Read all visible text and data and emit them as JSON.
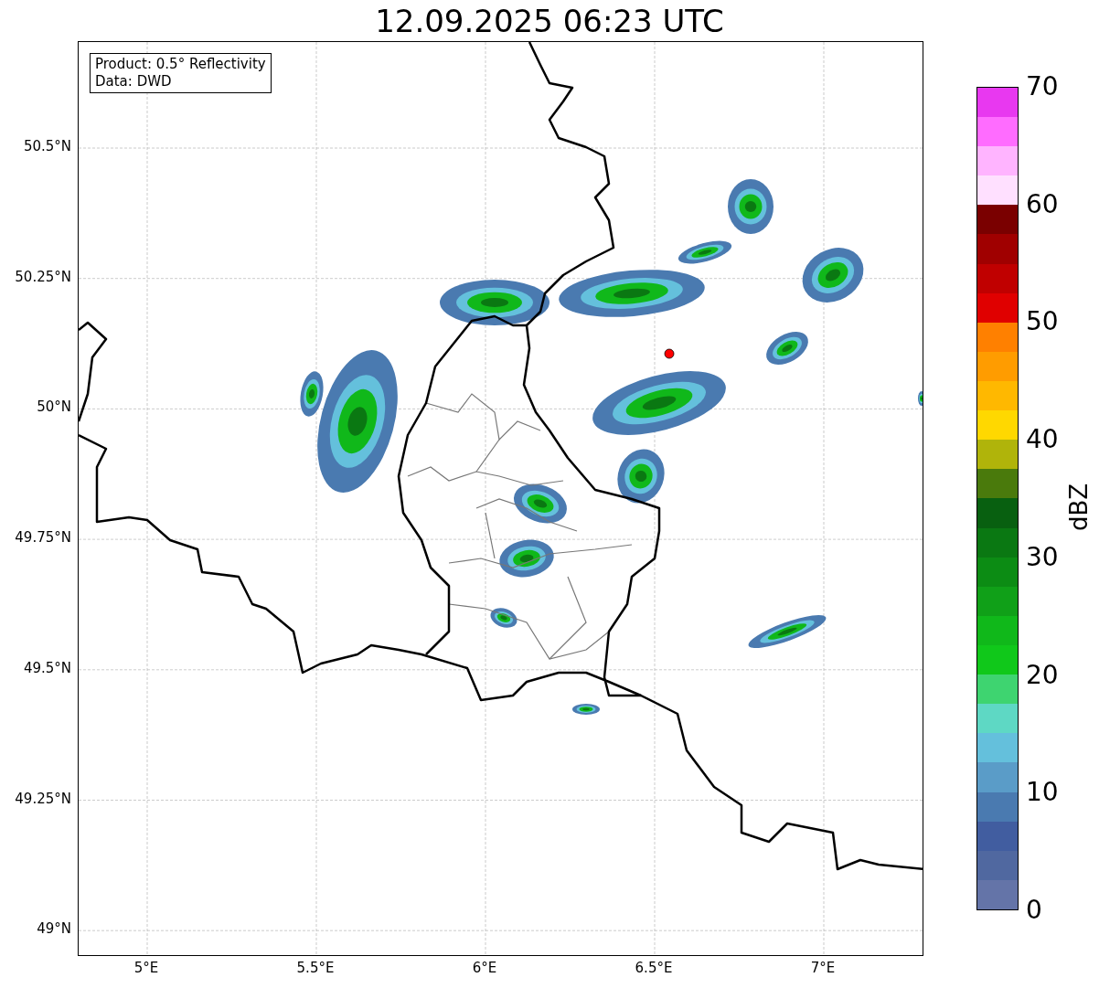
{
  "title": "12.09.2025 06:23 UTC",
  "info_box": [
    "Product: 0.5° Reflectivity",
    "Data: DWD"
  ],
  "x_axis_ticks": [
    "5°E",
    "5.5°E",
    "6°E",
    "6.5°E",
    "7°E"
  ],
  "y_axis_ticks": [
    "50.5°N",
    "50.25°N",
    "50°N",
    "49.75°N",
    "49.5°N",
    "49.25°N",
    "49°N"
  ],
  "colorbar": {
    "label": "dBZ",
    "ticks": [
      "70",
      "60",
      "50",
      "40",
      "30",
      "20",
      "10",
      "0"
    ],
    "steps": [
      {
        "color": "#6474a8"
      },
      {
        "color": "#5068a0"
      },
      {
        "color": "#415da0"
      },
      {
        "color": "#4a7ab0"
      },
      {
        "color": "#5a9cc8"
      },
      {
        "color": "#64c0dc"
      },
      {
        "color": "#5ed8c4"
      },
      {
        "color": "#3ed470"
      },
      {
        "color": "#10c81a"
      },
      {
        "color": "#10b81a"
      },
      {
        "color": "#10a018"
      },
      {
        "color": "#0c8c14"
      },
      {
        "color": "#0a7812"
      },
      {
        "color": "#086010"
      },
      {
        "color": "#4a7a0c"
      },
      {
        "color": "#b0b40a"
      },
      {
        "color": "#ffd800"
      },
      {
        "color": "#ffb800"
      },
      {
        "color": "#ff9c00"
      },
      {
        "color": "#ff8000"
      },
      {
        "color": "#e00000"
      },
      {
        "color": "#c00000"
      },
      {
        "color": "#a00000"
      },
      {
        "color": "#7a0000"
      },
      {
        "color": "#ffe0ff"
      },
      {
        "color": "#ffb4ff"
      },
      {
        "color": "#ff6cff"
      },
      {
        "color": "#e838f0"
      }
    ]
  }
}
